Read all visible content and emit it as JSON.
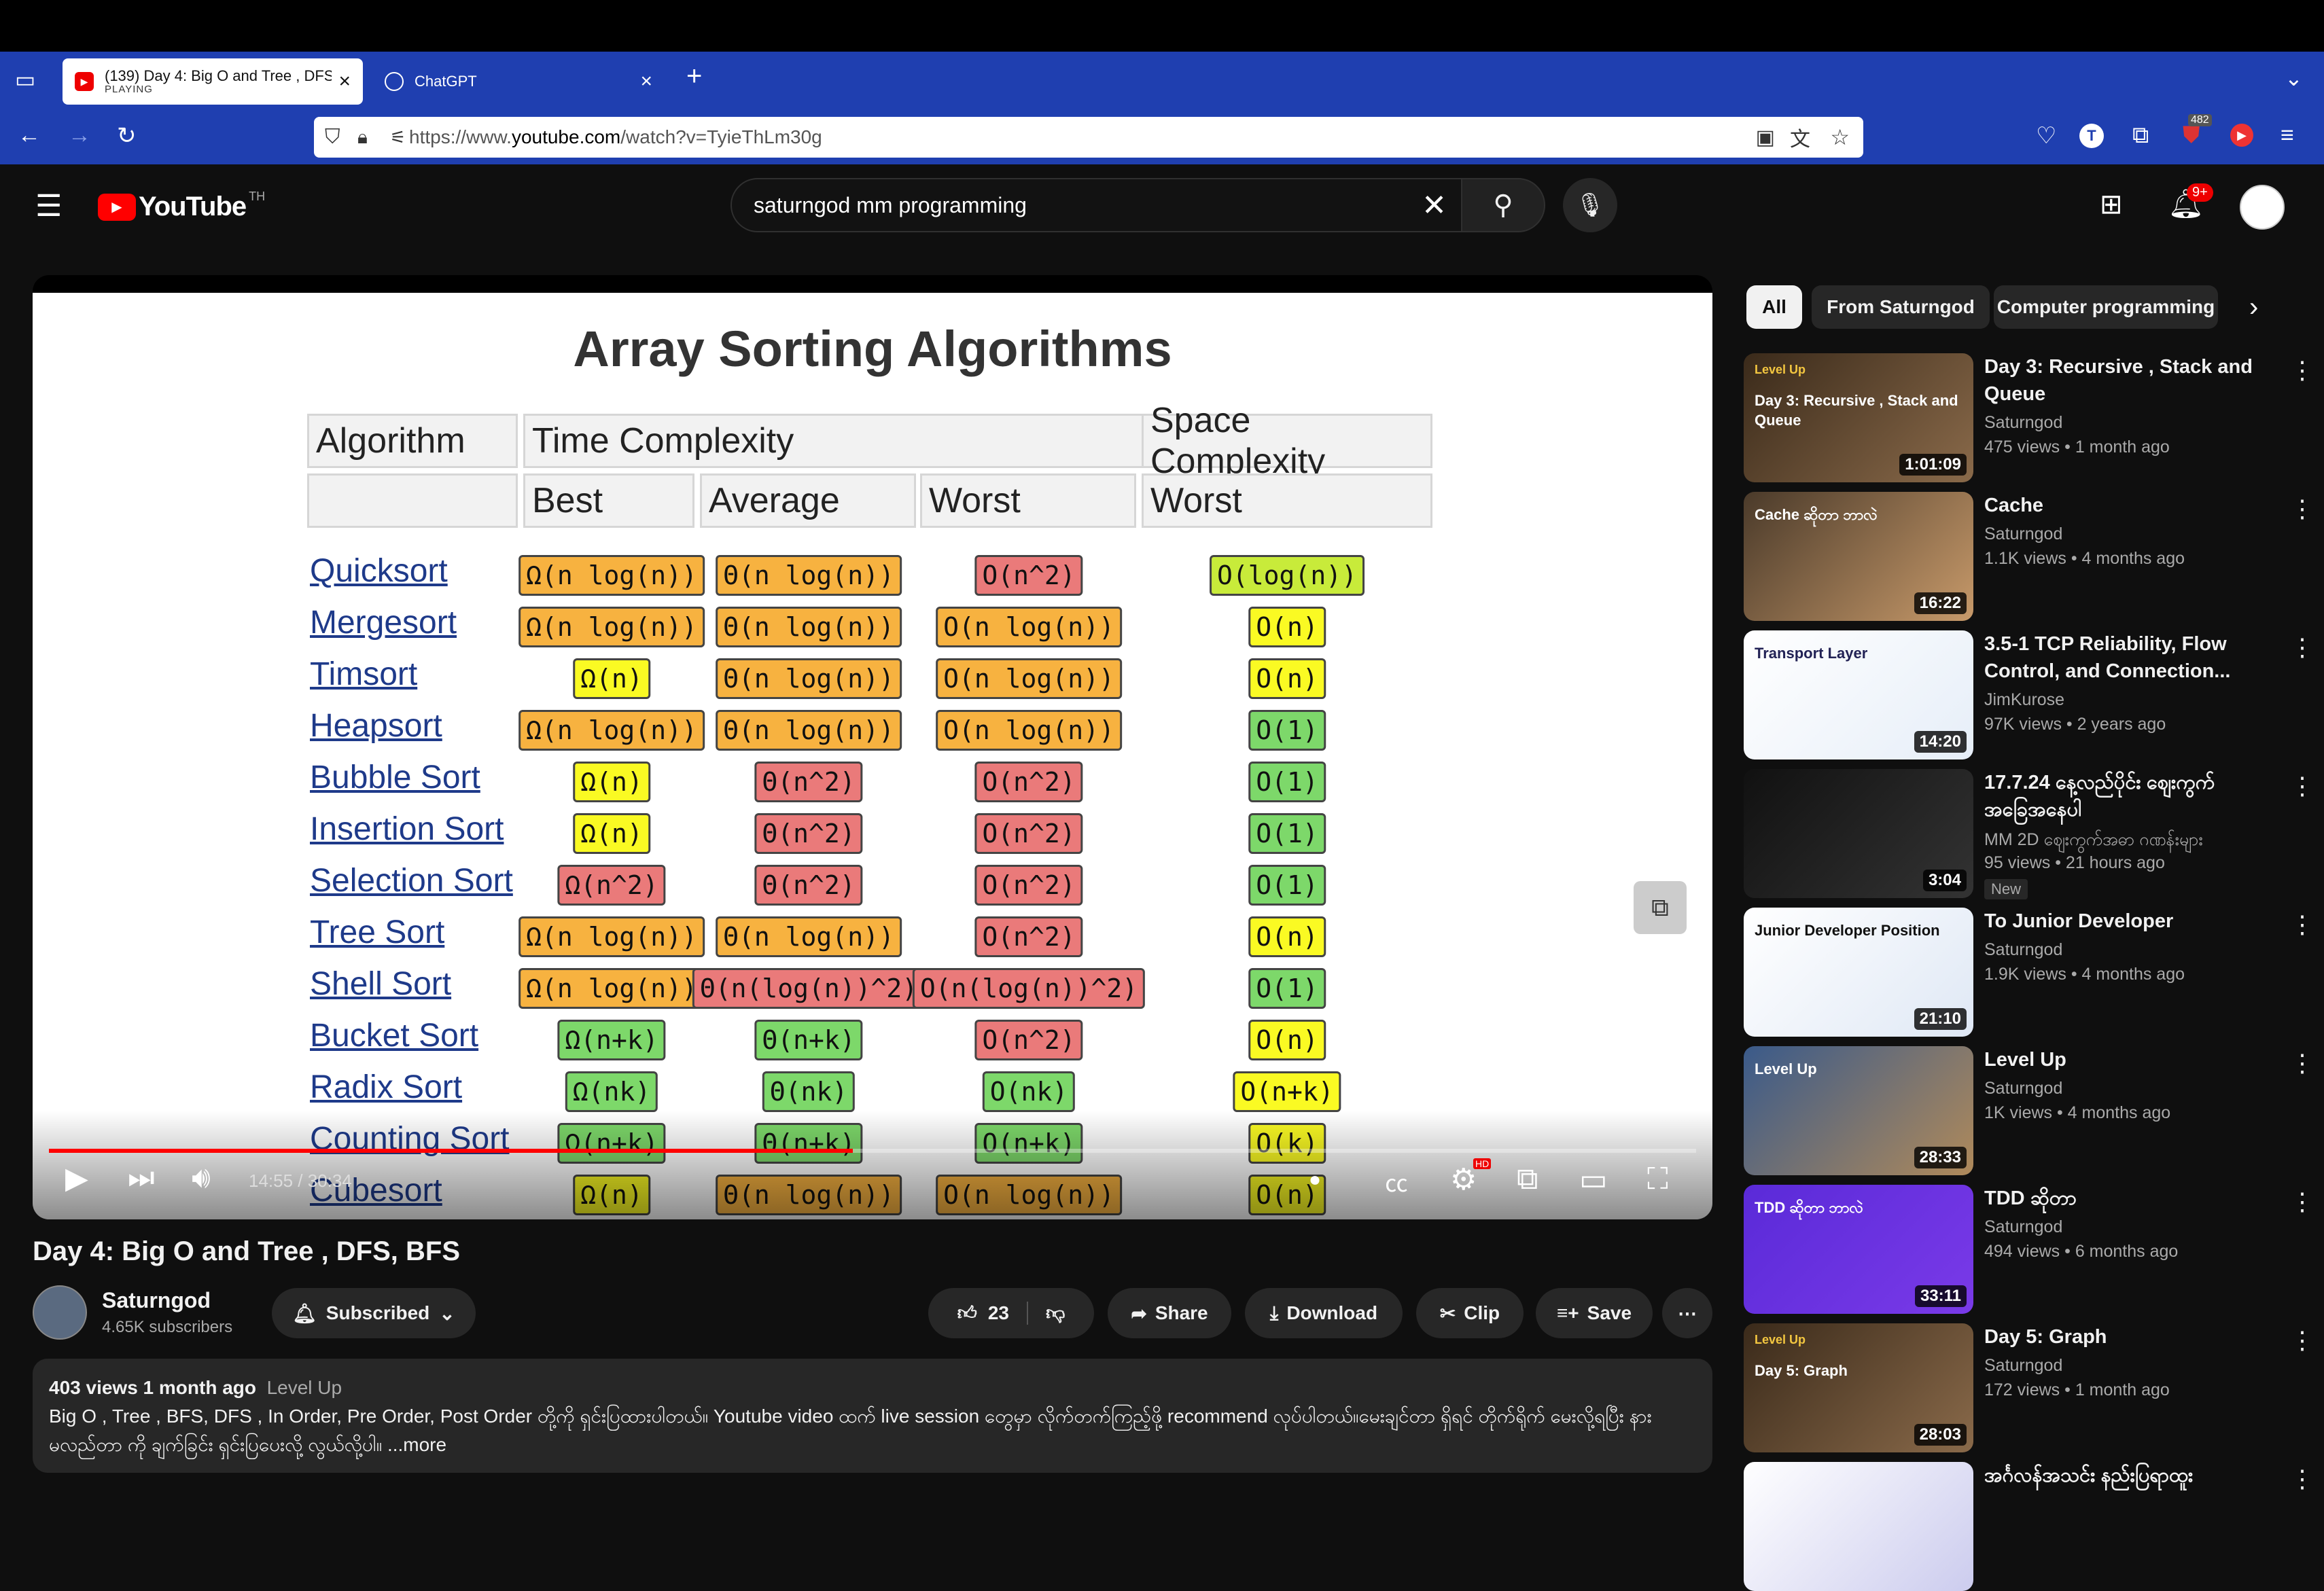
{
  "browser": {
    "tabs": [
      {
        "title": "(139) Day 4: Big O and Tree , DFS",
        "sub": "PLAYING"
      },
      {
        "title": "ChatGPT",
        "sub": ""
      }
    ],
    "new_tab": "+",
    "url_prefix": "https://www.",
    "url_domain": "youtube.com",
    "url_path": "/watch?v=TyieThLm30g",
    "ext_badge": "482"
  },
  "youtube": {
    "logo": "YouTube",
    "region": "TH",
    "search_value": "saturngod mm programming",
    "notif_badge": "9+"
  },
  "slide": {
    "title": "Array Sorting Algorithms",
    "header": {
      "algorithm": "Algorithm",
      "time": "Time Complexity",
      "space": "Space Complexity",
      "best": "Best",
      "average": "Average",
      "worst": "Worst",
      "space_worst": "Worst"
    },
    "rows": [
      {
        "name": "Quicksort",
        "best": "Ω(n log(n))",
        "avg": "Θ(n log(n))",
        "worst": "O(n^2)",
        "space": "O(log(n))"
      },
      {
        "name": "Mergesort",
        "best": "Ω(n log(n))",
        "avg": "Θ(n log(n))",
        "worst": "O(n log(n))",
        "space": "O(n)"
      },
      {
        "name": "Timsort",
        "best": "Ω(n)",
        "avg": "Θ(n log(n))",
        "worst": "O(n log(n))",
        "space": "O(n)"
      },
      {
        "name": "Heapsort",
        "best": "Ω(n log(n))",
        "avg": "Θ(n log(n))",
        "worst": "O(n log(n))",
        "space": "O(1)"
      },
      {
        "name": "Bubble Sort",
        "best": "Ω(n)",
        "avg": "Θ(n^2)",
        "worst": "O(n^2)",
        "space": "O(1)"
      },
      {
        "name": "Insertion Sort",
        "best": "Ω(n)",
        "avg": "Θ(n^2)",
        "worst": "O(n^2)",
        "space": "O(1)"
      },
      {
        "name": "Selection Sort",
        "best": "Ω(n^2)",
        "avg": "Θ(n^2)",
        "worst": "O(n^2)",
        "space": "O(1)"
      },
      {
        "name": "Tree Sort",
        "best": "Ω(n log(n))",
        "avg": "Θ(n log(n))",
        "worst": "O(n^2)",
        "space": "O(n)"
      },
      {
        "name": "Shell Sort",
        "best": "Ω(n log(n))",
        "avg": "Θ(n(log(n))^2)",
        "worst": "O(n(log(n))^2)",
        "space": "O(1)"
      },
      {
        "name": "Bucket Sort",
        "best": "Ω(n+k)",
        "avg": "Θ(n+k)",
        "worst": "O(n^2)",
        "space": "O(n)"
      },
      {
        "name": "Radix Sort",
        "best": "Ω(nk)",
        "avg": "Θ(nk)",
        "worst": "O(nk)",
        "space": "O(n+k)"
      },
      {
        "name": "Counting Sort",
        "best": "Ω(n+k)",
        "avg": "Θ(n+k)",
        "worst": "O(n+k)",
        "space": "O(k)"
      },
      {
        "name": "Cubesort",
        "best": "Ω(n)",
        "avg": "Θ(n log(n))",
        "worst": "O(n log(n))",
        "space": "O(n)"
      }
    ],
    "colors": {
      "yellow": "#fafa23",
      "orange": "#f7b240",
      "red": "#ea7a7a",
      "green": "#7dd86a",
      "lime": "#c8eb3a"
    }
  },
  "player": {
    "time": "14:55 / 30:34",
    "progress": 0.488,
    "hd_badge": "HD"
  },
  "video": {
    "title": "Day 4: Big O and Tree , DFS, BFS",
    "channel": "Saturngod",
    "subscribers": "4.65K subscribers",
    "subscribed_label": "Subscribed",
    "likes": "23",
    "share": "Share",
    "download": "Download",
    "clip": "Clip",
    "save": "Save",
    "views_date": "403 views  1 month ago",
    "tag": "Level Up",
    "description": "Big O , Tree , BFS, DFS , In Order, Pre Order, Post Order တို့ကို ရှင်းပြထားပါတယ်။ Youtube video ထက် live session တွေမှာ လိုက်တက်ကြည့်ဖို့ recommend လုပ်ပါတယ်။မေးချင်တာ ရှိရင် တိုက်ရိုက် မေးလို့ရပြီး နား",
    "description2": "မလည်တာ ကို ချက်ခြင်း ရှင်းပြပေးလို့ လွယ်လို့ပါ။ ...more"
  },
  "sidebar": {
    "chips": [
      "All",
      "From Saturngod",
      "Computer programming"
    ],
    "items": [
      {
        "title": "Day 3: Recursive , Stack and Queue",
        "channel": "Saturngod",
        "meta": "475 views  • 1 month ago",
        "duration": "1:01:09",
        "thumb_text": "Day 3: Recursive , Stack and Queue",
        "thumb_tag": "Level Up"
      },
      {
        "title": "Cache",
        "channel": "Saturngod",
        "meta": "1.1K views  • 4 months ago",
        "duration": "16:22",
        "thumb_text": "Cache ဆိုတာ ဘာလဲ",
        "thumb_tag": ""
      },
      {
        "title": "3.5-1 TCP Reliability, Flow Control, and Connection...",
        "channel": "JimKurose",
        "meta": "97K views  • 2 years ago",
        "duration": "14:20",
        "thumb_text": "Transport Layer",
        "thumb_tag": ""
      },
      {
        "title": "17.7.24 နေ့လည်ပိုင်း ဈေးကွက် အခြေအနေပါ",
        "channel": "MM 2D ဈေးကွက်အဓာ ဂဏန်းများ",
        "meta": "95 views  • 21 hours ago",
        "duration": "3:04",
        "thumb_text": "",
        "thumb_tag": "",
        "badge": "New"
      },
      {
        "title": "To Junior Developer",
        "channel": "Saturngod",
        "meta": "1.9K views  • 4 months ago",
        "duration": "21:10",
        "thumb_text": "Junior Developer Position",
        "thumb_tag": ""
      },
      {
        "title": "Level Up",
        "channel": "Saturngod",
        "meta": "1K views  • 4 months ago",
        "duration": "28:33",
        "thumb_text": "Level Up",
        "thumb_tag": ""
      },
      {
        "title": "TDD ဆိုတာ",
        "channel": "Saturngod",
        "meta": "494 views  • 6 months ago",
        "duration": "33:11",
        "thumb_text": "TDD ဆိုတာ ဘာလဲ",
        "thumb_tag": ""
      },
      {
        "title": "Day 5: Graph",
        "channel": "Saturngod",
        "meta": "172 views  • 1 month ago",
        "duration": "28:03",
        "thumb_text": "Day 5: Graph",
        "thumb_tag": "Level Up"
      },
      {
        "title": "အင်္ဂလန်အသင်း နည်းပြရာထူး",
        "channel": "",
        "meta": "",
        "duration": "",
        "thumb_text": "",
        "thumb_tag": ""
      }
    ]
  }
}
